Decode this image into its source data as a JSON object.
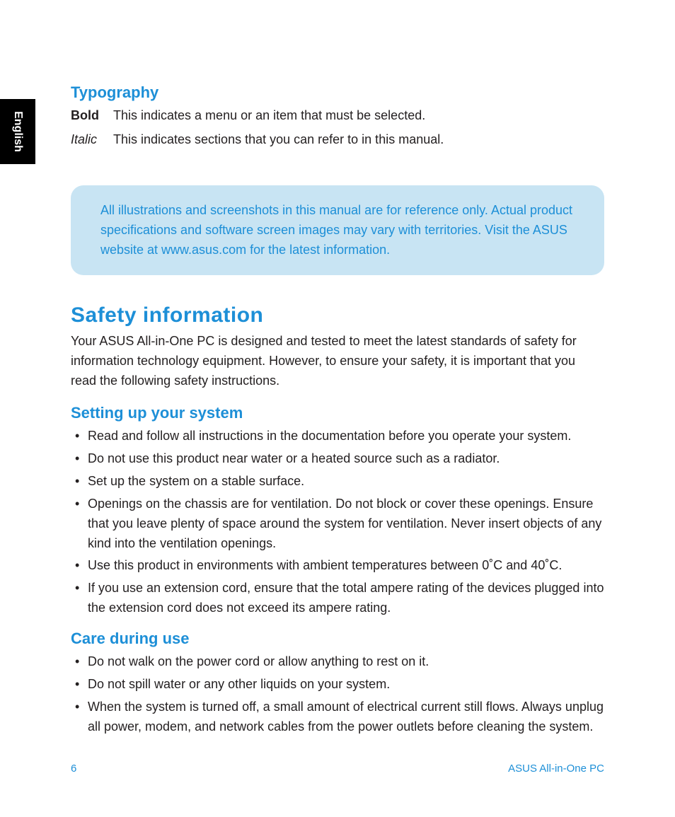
{
  "language_tab": "English",
  "typography": {
    "heading": "Typography",
    "rows": [
      {
        "label": "Bold",
        "style": "bold",
        "desc": "This indicates a menu or an item that must be selected."
      },
      {
        "label": "Italic",
        "style": "italic",
        "desc": "This indicates sections that you can refer to in this manual."
      }
    ]
  },
  "note": "All illustrations and screenshots in this manual are for reference only. Actual product specifications and software screen images may vary with territories. Visit the ASUS website at www.asus.com for the latest information.",
  "safety": {
    "heading": "Safety information",
    "intro": "Your ASUS All-in-One PC is designed and tested to meet the latest standards of safety for information technology equipment. However, to ensure your safety, it is important that you read the following safety instructions."
  },
  "setup": {
    "heading": "Setting up your system",
    "items": [
      "Read and follow all instructions in the documentation before you operate your system.",
      "Do not use this product near water or a heated source such as a radiator.",
      "Set up the system on a stable surface.",
      "Openings on the chassis are for ventilation. Do not block or cover these openings. Ensure that you leave plenty of space around the system for ventilation. Never insert objects of any kind into the ventilation openings.",
      "Use this product in environments with ambient temperatures between 0˚C and 40˚C.",
      "If you use an extension cord, ensure that the total ampere rating of the devices plugged into the extension cord does not exceed its ampere rating."
    ]
  },
  "care": {
    "heading": "Care during use",
    "items": [
      "Do not walk on the power cord or allow anything to rest on it.",
      "Do not spill water or any other liquids on your system.",
      "When the system is turned off, a small amount of electrical current still flows. Always unplug all power, modem, and network cables from the power outlets before cleaning the system."
    ]
  },
  "footer": {
    "page_number": "6",
    "product": "ASUS All-in-One PC"
  }
}
